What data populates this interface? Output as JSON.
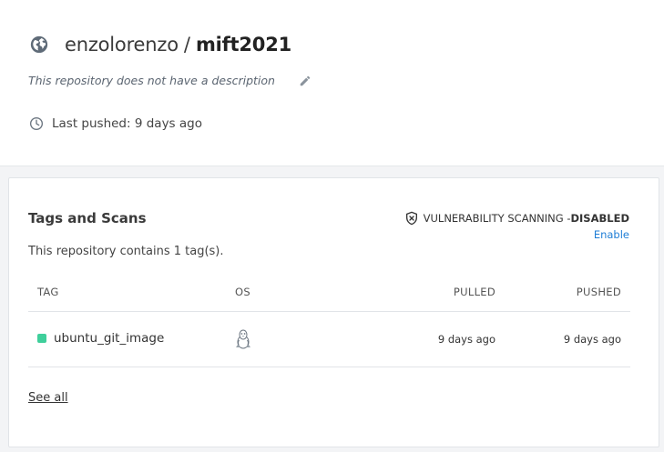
{
  "repo": {
    "owner": "enzolorenzo",
    "separator": "/",
    "name": "mift2021",
    "description": "This repository does not have a description",
    "last_pushed": "Last pushed: 9 days ago"
  },
  "tags_card": {
    "title": "Tags and Scans",
    "vulnerability_label": "VULNERABILITY SCANNING - ",
    "vulnerability_status": "DISABLED",
    "enable_link": "Enable",
    "subtitle": "This repository contains 1 tag(s).",
    "columns": {
      "tag": "TAG",
      "os": "OS",
      "pulled": "PULLED",
      "pushed": "PUSHED"
    },
    "rows": [
      {
        "tag": "ubuntu_git_image",
        "os_icon": "linux-icon",
        "pulled": "9 days ago",
        "pushed": "9 days ago",
        "status_color": "#3fcf9b"
      }
    ],
    "see_all": "See all"
  },
  "icons": {
    "visibility": "globe-icon",
    "edit": "pencil-icon",
    "time": "clock-icon",
    "scan": "shield-x-icon"
  },
  "colors": {
    "link": "#1f7ed6",
    "status_ok": "#3fcf9b"
  }
}
